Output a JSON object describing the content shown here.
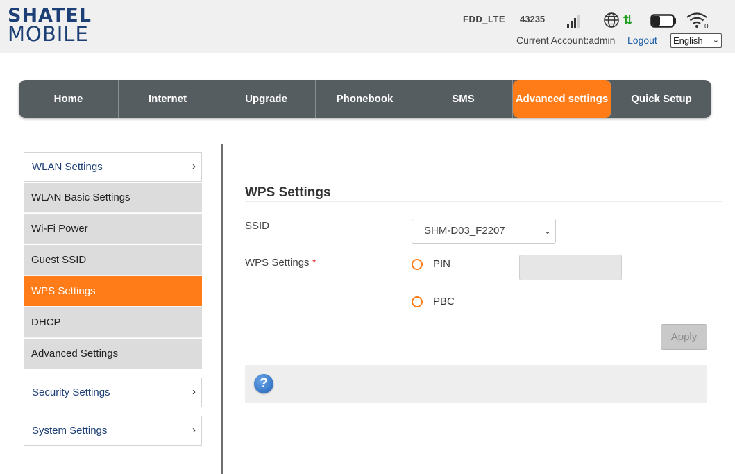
{
  "header": {
    "logo_line1": "SHATEL",
    "logo_line2": "MOBILE",
    "network_type": "FDD_LTE",
    "operator_code": "43235",
    "account_text": "Current Account:admin",
    "logout_label": "Logout",
    "language_value": "English",
    "icons": [
      "signal-bars-icon",
      "globe-icon",
      "data-arrows-icon",
      "battery-icon",
      "wifi-icon"
    ],
    "wifi_clients": "0"
  },
  "nav": {
    "items": [
      {
        "label": "Home"
      },
      {
        "label": "Internet"
      },
      {
        "label": "Upgrade"
      },
      {
        "label": "Phonebook"
      },
      {
        "label": "SMS"
      },
      {
        "label": "Advanced settings"
      },
      {
        "label": "Quick Setup"
      }
    ],
    "active_index": 5
  },
  "sidebar": {
    "groups": [
      {
        "label": "WLAN Settings"
      },
      {
        "label": "Security Settings"
      },
      {
        "label": "System Settings"
      }
    ],
    "wlan_items": [
      {
        "label": "WLAN Basic Settings"
      },
      {
        "label": "Wi-Fi Power"
      },
      {
        "label": "Guest SSID"
      },
      {
        "label": "WPS Settings"
      },
      {
        "label": "DHCP"
      },
      {
        "label": "Advanced Settings"
      }
    ],
    "active_item": "WPS Settings"
  },
  "content": {
    "title": "WPS Settings",
    "ssid_label": "SSID",
    "ssid_value": "SHM-D03_F2207",
    "wps_label": "WPS Settings",
    "required_mark": "*",
    "option_pin": "PIN",
    "option_pbc": "PBC",
    "pin_value": "",
    "apply_label": "Apply",
    "help_icon_text": "?"
  },
  "colors": {
    "accent": "#ff7c18",
    "nav_bg": "#565d60",
    "link": "#1f5fa8",
    "brand": "#1c3f75"
  }
}
